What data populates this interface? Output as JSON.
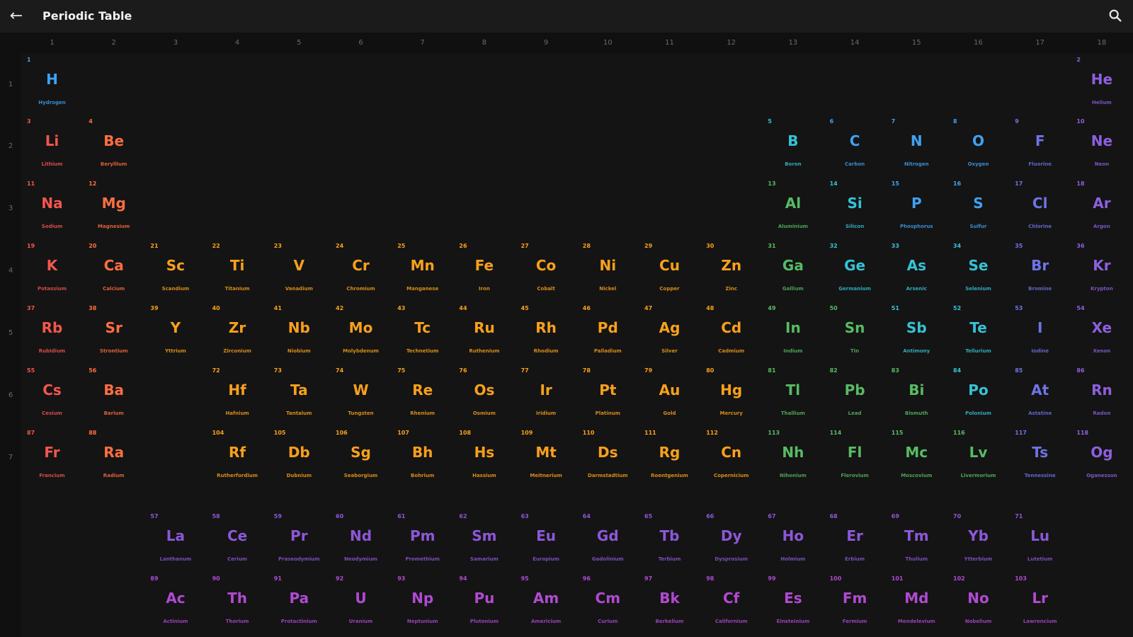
{
  "appbar": {
    "title": "Periodic Table",
    "back_icon": "arrow-left-icon",
    "search_icon": "search-icon"
  },
  "colors": {
    "alkali": "#f4564e",
    "alkaline_earth": "#ff6e40",
    "transition": "#f9a01b",
    "post_transition": "#57bb63",
    "metalloid": "#35c3d6",
    "nonmetal": "#3fa2f3",
    "halogen": "#6f74e6",
    "noble_gas": "#8e5fe0",
    "lanthanide": "#8d57d8",
    "actinide": "#b04ad3",
    "background": "#141414",
    "header": "#101010"
  },
  "groups": [
    "1",
    "2",
    "3",
    "4",
    "5",
    "6",
    "7",
    "8",
    "9",
    "10",
    "11",
    "12",
    "13",
    "14",
    "15",
    "16",
    "17",
    "18"
  ],
  "periods": [
    "1",
    "2",
    "3",
    "4",
    "5",
    "6",
    "7"
  ],
  "elements": [
    {
      "n": "1",
      "s": "H",
      "name": "Hydrogen",
      "g": 1,
      "p": 1,
      "c": "nonmetal"
    },
    {
      "n": "2",
      "s": "He",
      "name": "Helium",
      "g": 18,
      "p": 1,
      "c": "noble_gas"
    },
    {
      "n": "3",
      "s": "Li",
      "name": "Lithium",
      "g": 1,
      "p": 2,
      "c": "alkali"
    },
    {
      "n": "4",
      "s": "Be",
      "name": "Beryllium",
      "g": 2,
      "p": 2,
      "c": "alkaline_earth"
    },
    {
      "n": "5",
      "s": "B",
      "name": "Boron",
      "g": 13,
      "p": 2,
      "c": "metalloid"
    },
    {
      "n": "6",
      "s": "C",
      "name": "Carbon",
      "g": 14,
      "p": 2,
      "c": "nonmetal"
    },
    {
      "n": "7",
      "s": "N",
      "name": "Nitrogen",
      "g": 15,
      "p": 2,
      "c": "nonmetal"
    },
    {
      "n": "8",
      "s": "O",
      "name": "Oxygen",
      "g": 16,
      "p": 2,
      "c": "nonmetal"
    },
    {
      "n": "9",
      "s": "F",
      "name": "Fluorine",
      "g": 17,
      "p": 2,
      "c": "halogen"
    },
    {
      "n": "10",
      "s": "Ne",
      "name": "Neon",
      "g": 18,
      "p": 2,
      "c": "noble_gas"
    },
    {
      "n": "11",
      "s": "Na",
      "name": "Sodium",
      "g": 1,
      "p": 3,
      "c": "alkali"
    },
    {
      "n": "12",
      "s": "Mg",
      "name": "Magnesium",
      "g": 2,
      "p": 3,
      "c": "alkaline_earth"
    },
    {
      "n": "13",
      "s": "Al",
      "name": "Aluminium",
      "g": 13,
      "p": 3,
      "c": "post_transition"
    },
    {
      "n": "14",
      "s": "Si",
      "name": "Silicon",
      "g": 14,
      "p": 3,
      "c": "metalloid"
    },
    {
      "n": "15",
      "s": "P",
      "name": "Phosphorus",
      "g": 15,
      "p": 3,
      "c": "nonmetal"
    },
    {
      "n": "16",
      "s": "S",
      "name": "Sulfur",
      "g": 16,
      "p": 3,
      "c": "nonmetal"
    },
    {
      "n": "17",
      "s": "Cl",
      "name": "Chlorine",
      "g": 17,
      "p": 3,
      "c": "halogen"
    },
    {
      "n": "18",
      "s": "Ar",
      "name": "Argon",
      "g": 18,
      "p": 3,
      "c": "noble_gas"
    },
    {
      "n": "19",
      "s": "K",
      "name": "Potassium",
      "g": 1,
      "p": 4,
      "c": "alkali"
    },
    {
      "n": "20",
      "s": "Ca",
      "name": "Calcium",
      "g": 2,
      "p": 4,
      "c": "alkaline_earth"
    },
    {
      "n": "21",
      "s": "Sc",
      "name": "Scandium",
      "g": 3,
      "p": 4,
      "c": "transition"
    },
    {
      "n": "22",
      "s": "Ti",
      "name": "Titanium",
      "g": 4,
      "p": 4,
      "c": "transition"
    },
    {
      "n": "23",
      "s": "V",
      "name": "Vanadium",
      "g": 5,
      "p": 4,
      "c": "transition"
    },
    {
      "n": "24",
      "s": "Cr",
      "name": "Chromium",
      "g": 6,
      "p": 4,
      "c": "transition"
    },
    {
      "n": "25",
      "s": "Mn",
      "name": "Manganese",
      "g": 7,
      "p": 4,
      "c": "transition"
    },
    {
      "n": "26",
      "s": "Fe",
      "name": "Iron",
      "g": 8,
      "p": 4,
      "c": "transition"
    },
    {
      "n": "27",
      "s": "Co",
      "name": "Cobalt",
      "g": 9,
      "p": 4,
      "c": "transition"
    },
    {
      "n": "28",
      "s": "Ni",
      "name": "Nickel",
      "g": 10,
      "p": 4,
      "c": "transition"
    },
    {
      "n": "29",
      "s": "Cu",
      "name": "Copper",
      "g": 11,
      "p": 4,
      "c": "transition"
    },
    {
      "n": "30",
      "s": "Zn",
      "name": "Zinc",
      "g": 12,
      "p": 4,
      "c": "transition"
    },
    {
      "n": "31",
      "s": "Ga",
      "name": "Gallium",
      "g": 13,
      "p": 4,
      "c": "post_transition"
    },
    {
      "n": "32",
      "s": "Ge",
      "name": "Germanium",
      "g": 14,
      "p": 4,
      "c": "metalloid"
    },
    {
      "n": "33",
      "s": "As",
      "name": "Arsenic",
      "g": 15,
      "p": 4,
      "c": "metalloid"
    },
    {
      "n": "34",
      "s": "Se",
      "name": "Selenium",
      "g": 16,
      "p": 4,
      "c": "metalloid"
    },
    {
      "n": "35",
      "s": "Br",
      "name": "Bromine",
      "g": 17,
      "p": 4,
      "c": "halogen"
    },
    {
      "n": "36",
      "s": "Kr",
      "name": "Krypton",
      "g": 18,
      "p": 4,
      "c": "noble_gas"
    },
    {
      "n": "37",
      "s": "Rb",
      "name": "Rubidium",
      "g": 1,
      "p": 5,
      "c": "alkali"
    },
    {
      "n": "38",
      "s": "Sr",
      "name": "Strontium",
      "g": 2,
      "p": 5,
      "c": "alkaline_earth"
    },
    {
      "n": "39",
      "s": "Y",
      "name": "Yttrium",
      "g": 3,
      "p": 5,
      "c": "transition"
    },
    {
      "n": "40",
      "s": "Zr",
      "name": "Zirconium",
      "g": 4,
      "p": 5,
      "c": "transition"
    },
    {
      "n": "41",
      "s": "Nb",
      "name": "Niobium",
      "g": 5,
      "p": 5,
      "c": "transition"
    },
    {
      "n": "42",
      "s": "Mo",
      "name": "Molybdenum",
      "g": 6,
      "p": 5,
      "c": "transition"
    },
    {
      "n": "43",
      "s": "Tc",
      "name": "Technetium",
      "g": 7,
      "p": 5,
      "c": "transition"
    },
    {
      "n": "44",
      "s": "Ru",
      "name": "Ruthenium",
      "g": 8,
      "p": 5,
      "c": "transition"
    },
    {
      "n": "45",
      "s": "Rh",
      "name": "Rhodium",
      "g": 9,
      "p": 5,
      "c": "transition"
    },
    {
      "n": "46",
      "s": "Pd",
      "name": "Palladium",
      "g": 10,
      "p": 5,
      "c": "transition"
    },
    {
      "n": "47",
      "s": "Ag",
      "name": "Silver",
      "g": 11,
      "p": 5,
      "c": "transition"
    },
    {
      "n": "48",
      "s": "Cd",
      "name": "Cadmium",
      "g": 12,
      "p": 5,
      "c": "transition"
    },
    {
      "n": "49",
      "s": "In",
      "name": "Indium",
      "g": 13,
      "p": 5,
      "c": "post_transition"
    },
    {
      "n": "50",
      "s": "Sn",
      "name": "Tin",
      "g": 14,
      "p": 5,
      "c": "post_transition"
    },
    {
      "n": "51",
      "s": "Sb",
      "name": "Antimony",
      "g": 15,
      "p": 5,
      "c": "metalloid"
    },
    {
      "n": "52",
      "s": "Te",
      "name": "Tellurium",
      "g": 16,
      "p": 5,
      "c": "metalloid"
    },
    {
      "n": "53",
      "s": "I",
      "name": "Iodine",
      "g": 17,
      "p": 5,
      "c": "halogen"
    },
    {
      "n": "54",
      "s": "Xe",
      "name": "Xenon",
      "g": 18,
      "p": 5,
      "c": "noble_gas"
    },
    {
      "n": "55",
      "s": "Cs",
      "name": "Cesium",
      "g": 1,
      "p": 6,
      "c": "alkali"
    },
    {
      "n": "56",
      "s": "Ba",
      "name": "Barium",
      "g": 2,
      "p": 6,
      "c": "alkaline_earth"
    },
    {
      "n": "72",
      "s": "Hf",
      "name": "Hafnium",
      "g": 4,
      "p": 6,
      "c": "transition"
    },
    {
      "n": "73",
      "s": "Ta",
      "name": "Tantalum",
      "g": 5,
      "p": 6,
      "c": "transition"
    },
    {
      "n": "74",
      "s": "W",
      "name": "Tungsten",
      "g": 6,
      "p": 6,
      "c": "transition"
    },
    {
      "n": "75",
      "s": "Re",
      "name": "Rhenium",
      "g": 7,
      "p": 6,
      "c": "transition"
    },
    {
      "n": "76",
      "s": "Os",
      "name": "Osmium",
      "g": 8,
      "p": 6,
      "c": "transition"
    },
    {
      "n": "77",
      "s": "Ir",
      "name": "Iridium",
      "g": 9,
      "p": 6,
      "c": "transition"
    },
    {
      "n": "78",
      "s": "Pt",
      "name": "Platinum",
      "g": 10,
      "p": 6,
      "c": "transition"
    },
    {
      "n": "79",
      "s": "Au",
      "name": "Gold",
      "g": 11,
      "p": 6,
      "c": "transition"
    },
    {
      "n": "80",
      "s": "Hg",
      "name": "Mercury",
      "g": 12,
      "p": 6,
      "c": "transition"
    },
    {
      "n": "81",
      "s": "Tl",
      "name": "Thallium",
      "g": 13,
      "p": 6,
      "c": "post_transition"
    },
    {
      "n": "82",
      "s": "Pb",
      "name": "Lead",
      "g": 14,
      "p": 6,
      "c": "post_transition"
    },
    {
      "n": "83",
      "s": "Bi",
      "name": "Bismuth",
      "g": 15,
      "p": 6,
      "c": "post_transition"
    },
    {
      "n": "84",
      "s": "Po",
      "name": "Polonium",
      "g": 16,
      "p": 6,
      "c": "metalloid"
    },
    {
      "n": "85",
      "s": "At",
      "name": "Astatine",
      "g": 17,
      "p": 6,
      "c": "halogen"
    },
    {
      "n": "86",
      "s": "Rn",
      "name": "Radon",
      "g": 18,
      "p": 6,
      "c": "noble_gas"
    },
    {
      "n": "87",
      "s": "Fr",
      "name": "Francium",
      "g": 1,
      "p": 7,
      "c": "alkali"
    },
    {
      "n": "88",
      "s": "Ra",
      "name": "Radium",
      "g": 2,
      "p": 7,
      "c": "alkaline_earth"
    },
    {
      "n": "104",
      "s": "Rf",
      "name": "Rutherfordium",
      "g": 4,
      "p": 7,
      "c": "transition"
    },
    {
      "n": "105",
      "s": "Db",
      "name": "Dubnium",
      "g": 5,
      "p": 7,
      "c": "transition"
    },
    {
      "n": "106",
      "s": "Sg",
      "name": "Seaborgium",
      "g": 6,
      "p": 7,
      "c": "transition"
    },
    {
      "n": "107",
      "s": "Bh",
      "name": "Bohrium",
      "g": 7,
      "p": 7,
      "c": "transition"
    },
    {
      "n": "108",
      "s": "Hs",
      "name": "Hassium",
      "g": 8,
      "p": 7,
      "c": "transition"
    },
    {
      "n": "109",
      "s": "Mt",
      "name": "Meitnerium",
      "g": 9,
      "p": 7,
      "c": "transition"
    },
    {
      "n": "110",
      "s": "Ds",
      "name": "Darmstadtium",
      "g": 10,
      "p": 7,
      "c": "transition"
    },
    {
      "n": "111",
      "s": "Rg",
      "name": "Roentgenium",
      "g": 11,
      "p": 7,
      "c": "transition"
    },
    {
      "n": "112",
      "s": "Cn",
      "name": "Copernicium",
      "g": 12,
      "p": 7,
      "c": "transition"
    },
    {
      "n": "113",
      "s": "Nh",
      "name": "Nihonium",
      "g": 13,
      "p": 7,
      "c": "post_transition"
    },
    {
      "n": "114",
      "s": "Fl",
      "name": "Flerovium",
      "g": 14,
      "p": 7,
      "c": "post_transition"
    },
    {
      "n": "115",
      "s": "Mc",
      "name": "Moscovium",
      "g": 15,
      "p": 7,
      "c": "post_transition"
    },
    {
      "n": "116",
      "s": "Lv",
      "name": "Livermorium",
      "g": 16,
      "p": 7,
      "c": "post_transition"
    },
    {
      "n": "117",
      "s": "Ts",
      "name": "Tennessine",
      "g": 17,
      "p": 7,
      "c": "halogen"
    },
    {
      "n": "118",
      "s": "Og",
      "name": "Oganesson",
      "g": 18,
      "p": 7,
      "c": "noble_gas"
    },
    {
      "n": "57",
      "s": "La",
      "name": "Lanthanum",
      "g": 3,
      "p": 9,
      "c": "lanthanide"
    },
    {
      "n": "58",
      "s": "Ce",
      "name": "Cerium",
      "g": 4,
      "p": 9,
      "c": "lanthanide"
    },
    {
      "n": "59",
      "s": "Pr",
      "name": "Praseodymium",
      "g": 5,
      "p": 9,
      "c": "lanthanide"
    },
    {
      "n": "60",
      "s": "Nd",
      "name": "Neodymium",
      "g": 6,
      "p": 9,
      "c": "lanthanide"
    },
    {
      "n": "61",
      "s": "Pm",
      "name": "Promethium",
      "g": 7,
      "p": 9,
      "c": "lanthanide"
    },
    {
      "n": "62",
      "s": "Sm",
      "name": "Samarium",
      "g": 8,
      "p": 9,
      "c": "lanthanide"
    },
    {
      "n": "63",
      "s": "Eu",
      "name": "Europium",
      "g": 9,
      "p": 9,
      "c": "lanthanide"
    },
    {
      "n": "64",
      "s": "Gd",
      "name": "Gadolinium",
      "g": 10,
      "p": 9,
      "c": "lanthanide"
    },
    {
      "n": "65",
      "s": "Tb",
      "name": "Terbium",
      "g": 11,
      "p": 9,
      "c": "lanthanide"
    },
    {
      "n": "66",
      "s": "Dy",
      "name": "Dysprosium",
      "g": 12,
      "p": 9,
      "c": "lanthanide"
    },
    {
      "n": "67",
      "s": "Ho",
      "name": "Holmium",
      "g": 13,
      "p": 9,
      "c": "lanthanide"
    },
    {
      "n": "68",
      "s": "Er",
      "name": "Erbium",
      "g": 14,
      "p": 9,
      "c": "lanthanide"
    },
    {
      "n": "69",
      "s": "Tm",
      "name": "Thulium",
      "g": 15,
      "p": 9,
      "c": "lanthanide"
    },
    {
      "n": "70",
      "s": "Yb",
      "name": "Ytterbium",
      "g": 16,
      "p": 9,
      "c": "lanthanide"
    },
    {
      "n": "71",
      "s": "Lu",
      "name": "Lutetium",
      "g": 17,
      "p": 9,
      "c": "lanthanide"
    },
    {
      "n": "89",
      "s": "Ac",
      "name": "Actinium",
      "g": 3,
      "p": 10,
      "c": "actinide"
    },
    {
      "n": "90",
      "s": "Th",
      "name": "Thorium",
      "g": 4,
      "p": 10,
      "c": "actinide"
    },
    {
      "n": "91",
      "s": "Pa",
      "name": "Protactinium",
      "g": 5,
      "p": 10,
      "c": "actinide"
    },
    {
      "n": "92",
      "s": "U",
      "name": "Uranium",
      "g": 6,
      "p": 10,
      "c": "actinide"
    },
    {
      "n": "93",
      "s": "Np",
      "name": "Neptunium",
      "g": 7,
      "p": 10,
      "c": "actinide"
    },
    {
      "n": "94",
      "s": "Pu",
      "name": "Plutonium",
      "g": 8,
      "p": 10,
      "c": "actinide"
    },
    {
      "n": "95",
      "s": "Am",
      "name": "Americium",
      "g": 9,
      "p": 10,
      "c": "actinide"
    },
    {
      "n": "96",
      "s": "Cm",
      "name": "Curium",
      "g": 10,
      "p": 10,
      "c": "actinide"
    },
    {
      "n": "97",
      "s": "Bk",
      "name": "Berkelium",
      "g": 11,
      "p": 10,
      "c": "actinide"
    },
    {
      "n": "98",
      "s": "Cf",
      "name": "Californium",
      "g": 12,
      "p": 10,
      "c": "actinide"
    },
    {
      "n": "99",
      "s": "Es",
      "name": "Einsteinium",
      "g": 13,
      "p": 10,
      "c": "actinide"
    },
    {
      "n": "100",
      "s": "Fm",
      "name": "Fermium",
      "g": 14,
      "p": 10,
      "c": "actinide"
    },
    {
      "n": "101",
      "s": "Md",
      "name": "Mendelevium",
      "g": 15,
      "p": 10,
      "c": "actinide"
    },
    {
      "n": "102",
      "s": "No",
      "name": "Nobelium",
      "g": 16,
      "p": 10,
      "c": "actinide"
    },
    {
      "n": "103",
      "s": "Lr",
      "name": "Lawrencium",
      "g": 17,
      "p": 10,
      "c": "actinide"
    }
  ]
}
